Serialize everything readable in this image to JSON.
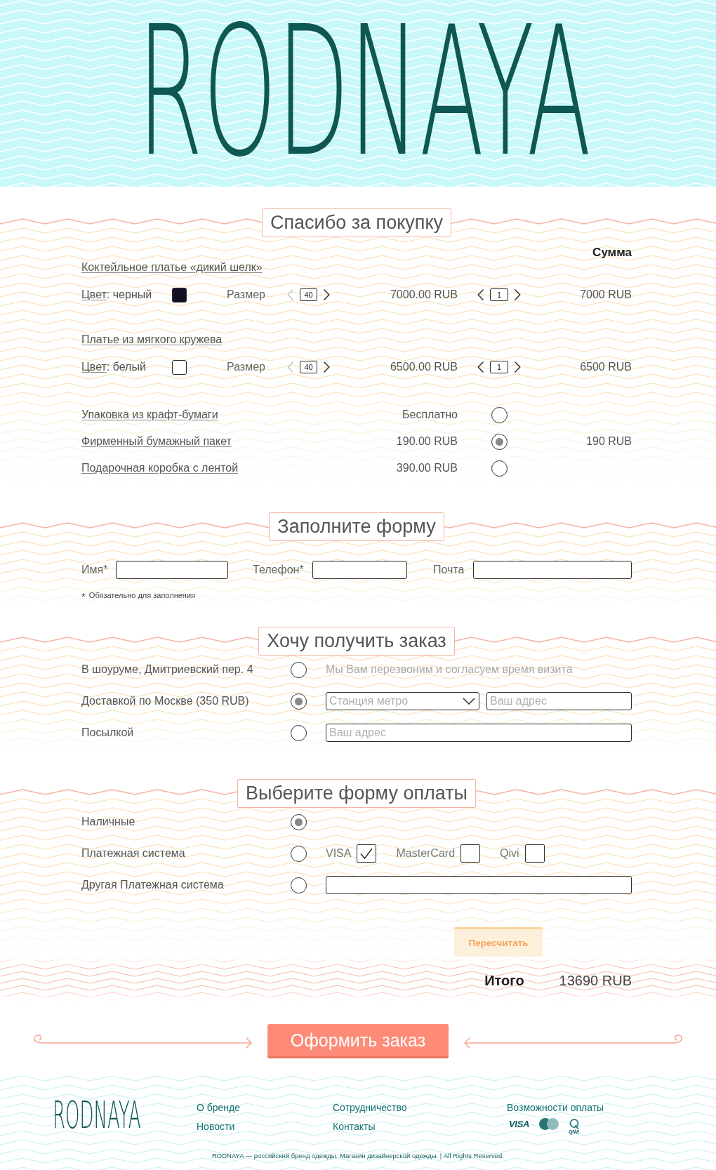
{
  "header": {
    "logo": "RODNAYA"
  },
  "order": {
    "title": "Спасибо за покупку",
    "sum_heading": "Сумма",
    "products": [
      {
        "name": "Коктейльное платье «дикий шелк»",
        "color_link": "Цвет",
        "color_name": ": черный",
        "color": "#150f22",
        "size_label": "Размер",
        "size": {
          "value": "40",
          "prev_disabled": true
        },
        "price": "7000.00 RUB",
        "quantity": {
          "value": "1",
          "prev_disabled": false
        },
        "total": "7000 RUB"
      },
      {
        "name": "Платье из мягкого кружева",
        "color_link": "Цвет",
        "color_name": ": белый",
        "color": "#ffffff",
        "size_label": "Размер",
        "size": {
          "value": "40",
          "prev_disabled": true
        },
        "price": "6500.00 RUB",
        "quantity": {
          "value": "1",
          "prev_disabled": false
        },
        "total": "6500 RUB"
      }
    ],
    "packaging": [
      {
        "name": "Упаковка из крафт-бумаги",
        "price": "Бесплатно",
        "selected": false
      },
      {
        "name": "Фирменный бумажный пакет",
        "price": "190.00 RUB",
        "selected": true,
        "total": "190 RUB"
      },
      {
        "name": "Подарочная коробка с лентой",
        "price": "390.00 RUB",
        "selected": false
      }
    ]
  },
  "contact": {
    "title": "Заполните форму",
    "fields": [
      {
        "label": "Имя*"
      },
      {
        "label": "Телефон*"
      },
      {
        "label": "Почта"
      }
    ],
    "note_mark": "*",
    "note": "Обязательно для заполнения"
  },
  "delivery": {
    "title": "Хочу получить заказ",
    "options": [
      {
        "label": "В шоуруме, Дмитриевский пер. 4",
        "selected": false,
        "kind": "note",
        "note": "Мы Вам перезвоним и согласуем время визита"
      },
      {
        "label": "Доставкой по Москве (350 RUB)",
        "selected": true,
        "kind": "metro_address",
        "select_placeholder": "Станция метро",
        "address_placeholder": "Ваш адрес"
      },
      {
        "label": "Посылкой",
        "selected": false,
        "kind": "address",
        "address_placeholder": "Ваш адрес"
      }
    ]
  },
  "payment": {
    "title": "Выберите форму оплаты",
    "options": [
      {
        "label": "Наличные",
        "selected": true,
        "kind": "plain"
      },
      {
        "label": "Платежная система",
        "selected": false,
        "kind": "systems",
        "systems": [
          {
            "label": "VISA",
            "checked": true
          },
          {
            "label": "MasterCard",
            "checked": false
          },
          {
            "label": "Qivi",
            "checked": false
          }
        ]
      },
      {
        "label": "Другая Платежная система",
        "selected": false,
        "kind": "field"
      }
    ]
  },
  "recalculate_button": "Пересчитать",
  "total": {
    "label": "Итого",
    "value": "13690 RUB"
  },
  "submit_button": "Оформить заказ",
  "footer": {
    "logo": "RODNAYA",
    "link_columns": [
      {
        "links": [
          "О бренде",
          "Новости"
        ]
      },
      {
        "links": [
          "Сотрудничество",
          "Контакты"
        ]
      }
    ],
    "payment_heading": "Возможности оплаты",
    "payment_logos": [
      {
        "kind": "visa",
        "text": "VISA"
      },
      {
        "kind": "mastercard"
      },
      {
        "kind": "qiwi",
        "text": "QIWI"
      }
    ],
    "copyright": "RODNAYA — российский бренд одежды. Магазин дизайнерской одежды. | All Rights Reserved."
  }
}
